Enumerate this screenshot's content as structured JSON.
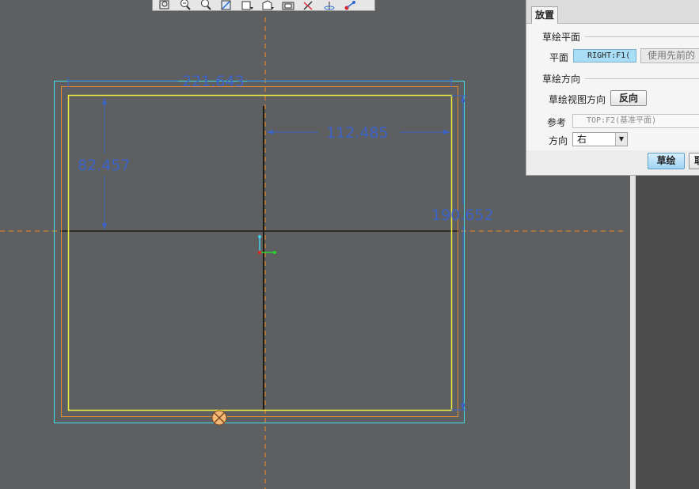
{
  "viewport": {
    "background": "#5e5f61",
    "colors": {
      "cyan_outline": "#3fe0ee",
      "yellow_outline": "#f2e93c",
      "orange_outline": "#e08a32",
      "dimension_blue": "#3b63c8",
      "centerline_orange": "#f08a24"
    },
    "dimensions": {
      "width_top": "221.643",
      "right_offset": "112.485",
      "left_height": "82.457",
      "right_height": "190.652"
    },
    "triad": {
      "x_color": "#26d62b",
      "y_color": "#45d2ec",
      "origin_color": "#e62626"
    },
    "marker": {
      "icon": "circle-x-icon",
      "fill": "#f7b878"
    }
  },
  "toolbar": {
    "buttons": [
      {
        "icon": "zoom-refit-icon"
      },
      {
        "icon": "zoom-in-icon"
      },
      {
        "icon": "zoom-out-icon"
      },
      {
        "icon": "repaint-icon"
      },
      {
        "icon": "display-style-icon"
      },
      {
        "icon": "saved-orientation-icon"
      },
      {
        "icon": "view-manager-icon"
      },
      {
        "icon": "datum-display-icon"
      },
      {
        "icon": "spin-center-icon"
      },
      {
        "icon": "annotation-display-icon"
      }
    ]
  },
  "dialog": {
    "tab_label": "放置",
    "sketch_plane": {
      "section_title": "草绘平面",
      "plane_label": "平面",
      "plane_value": "RIGHT:F1(",
      "use_previous_label": "使用先前的"
    },
    "orientation": {
      "section_title": "草绘方向",
      "view_dir_label": "草绘视图方向",
      "flip_label": "反向",
      "reference_label": "参考",
      "reference_value": "TOP:F2(基准平面)",
      "direction_label": "方向",
      "direction_value": "右"
    },
    "sketch_button_label": "草绘",
    "cancel_button_label": "取消"
  }
}
